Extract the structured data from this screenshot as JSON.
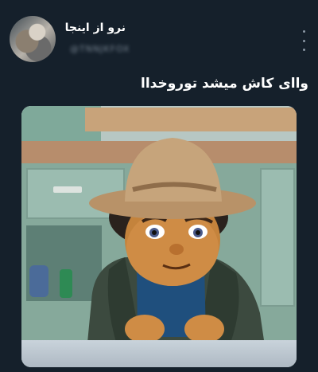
{
  "tweet": {
    "display_name": "نرو از اینجا",
    "handle": "@TNNJKFOX",
    "text": "واای کاش میشد توروخداا"
  },
  "colors": {
    "background": "#15202b",
    "text_primary": "#ffffff",
    "text_secondary": "#8b98a5"
  },
  "icons": {
    "more": "more-vertical-icon"
  }
}
